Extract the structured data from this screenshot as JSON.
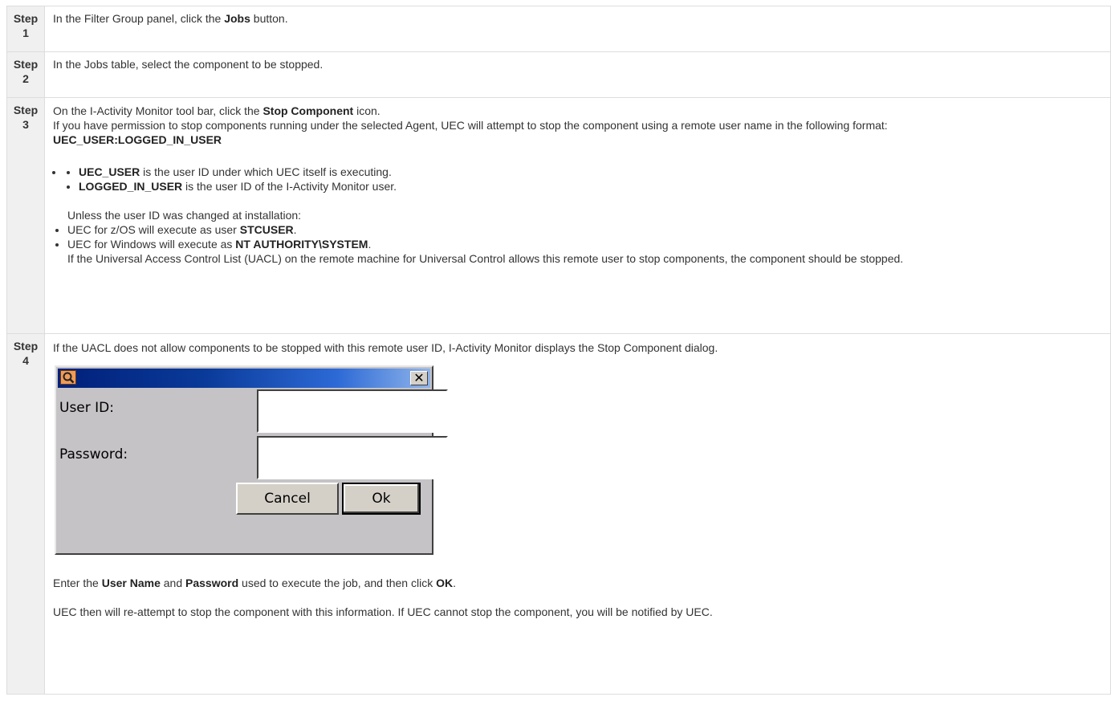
{
  "step_label": "Step",
  "steps": [
    {
      "num": "1",
      "before": "In the Filter Group panel, click the ",
      "bold": "Jobs",
      "after": " button."
    },
    {
      "num": "2",
      "text": "In the Jobs table, select the component to be stopped."
    },
    {
      "num": "3",
      "line1_before": "On the I-Activity Monitor tool bar, click the ",
      "line1_bold": "Stop Component",
      "line1_after": " icon.",
      "line2": "If you have permission to stop components running under the selected Agent, UEC will attempt to stop the component using a remote user name in the following format:",
      "format": "UEC_USER:LOGGED_IN_USER",
      "bullets": [
        {
          "bold": "UEC_USER",
          "text": " is the user ID under which UEC itself is executing."
        },
        {
          "bold": "LOGGED_IN_USER",
          "text": " is the user ID of the I-Activity Monitor user."
        }
      ],
      "unless": "Unless the user ID was changed at installation:",
      "os_items": [
        {
          "text": "UEC for z/OS will execute as user ",
          "bold": "STCUSER",
          "after": "."
        },
        {
          "text": "UEC for Windows will execute as ",
          "bold": "NT AUTHORITY\\SYSTEM",
          "after": "."
        }
      ],
      "uacl_note": "If the Universal Access Control List (UACL) on the remote machine for Universal Control allows this remote user to stop components, the component should be stopped."
    },
    {
      "num": "4",
      "intro": "If the UACL does not allow components to be stopped with this remote user ID, I-Activity Monitor displays the Stop Component dialog.",
      "enter_before": "Enter the ",
      "enter_bold1": "User Name",
      "enter_mid": " and ",
      "enter_bold2": "Password",
      "enter_after": " used to execute the job, and then click ",
      "enter_bold3": "OK",
      "enter_end": ".",
      "final": "UEC then will re-attempt to stop the component with this information. If UEC cannot stop the component, you will be notified by UEC."
    }
  ],
  "dialog": {
    "title_icon": "magnifier-icon",
    "close_glyph": "✕",
    "user_id_label": "User ID:",
    "password_label": "Password:",
    "user_id_value": "",
    "password_value": "",
    "cancel_label": "Cancel",
    "ok_label": "Ok"
  }
}
